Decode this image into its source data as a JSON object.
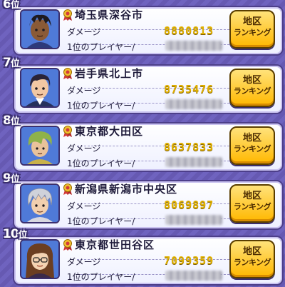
{
  "labels": {
    "damage": "ダメージ",
    "top_player": "1位のプレイヤー/",
    "button_line1": "地区",
    "button_line2": "ランキング"
  },
  "entries": [
    {
      "rank": "6",
      "rank_suffix": "位",
      "region": "埼玉県深谷市",
      "damage": "8880813",
      "avatar": "dark-skinned-boy-avatar"
    },
    {
      "rank": "7",
      "rank_suffix": "位",
      "region": "岩手県北上市",
      "damage": "8735476",
      "avatar": "dark-haired-man-avatar"
    },
    {
      "rank": "8",
      "rank_suffix": "位",
      "region": "東京都大田区",
      "damage": "8637833",
      "avatar": "green-haired-boy-avatar"
    },
    {
      "rank": "9",
      "rank_suffix": "位",
      "region": "新潟県新潟市中央区",
      "damage": "8069897",
      "avatar": "silver-haired-boy-avatar"
    },
    {
      "rank": "10",
      "rank_suffix": "位",
      "region": "東京都世田谷区",
      "damage": "7099359",
      "avatar": "brown-haired-woman-avatar"
    }
  ],
  "colors": {
    "background": "#6b5fb8",
    "damage_value": "#e0b000",
    "button": "#ffc21a"
  }
}
